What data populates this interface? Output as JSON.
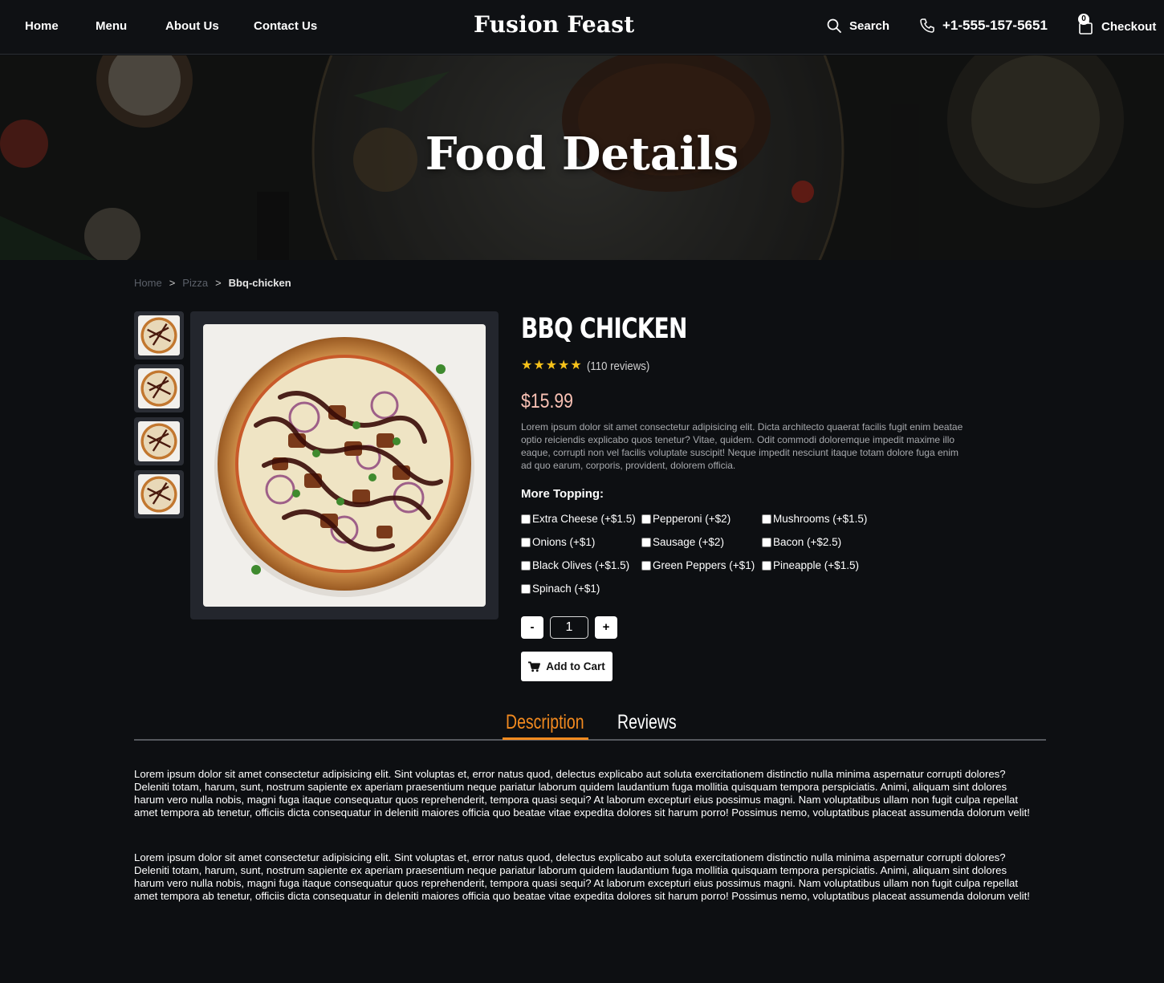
{
  "nav": {
    "links": [
      "Home",
      "Menu",
      "About Us",
      "Contact Us"
    ],
    "brand": "Fusion Feast",
    "search_label": "Search",
    "phone": "+1-555-157-5651",
    "cart_count": "0",
    "checkout_label": "Checkout"
  },
  "hero": {
    "title": "Food Details"
  },
  "breadcrumb": {
    "home": "Home",
    "category": "Pizza",
    "current": "Bbq-chicken",
    "separator": ">"
  },
  "product": {
    "title": "BBQ CHICKEN",
    "rating": 5,
    "reviews": "(110 reviews)",
    "price": "$15.99",
    "short_description": "Lorem ipsum dolor sit amet consectetur adipisicing elit. Dicta architecto quaerat facilis fugit enim beatae optio reiciendis explicabo quos tenetur? Vitae, quidem. Odit commodi doloremque impedit maxime illo eaque, corrupti non vel facilis voluptate suscipit! Neque impedit nesciunt itaque totam dolore fuga enim ad quo earum, corporis, provident, dolorem officia.",
    "topping_heading": "More Topping:",
    "toppings": [
      "Extra Cheese (+$1.5)",
      "Pepperoni (+$2)",
      "Mushrooms (+$1.5)",
      "Onions (+$1)",
      "Sausage (+$2)",
      "Bacon (+$2.5)",
      "Black Olives (+$1.5)",
      "Green Peppers (+$1)",
      "Pineapple (+$1.5)",
      "Spinach (+$1)"
    ],
    "quantity": "1",
    "minus_label": "-",
    "plus_label": "+",
    "add_to_cart": "Add to Cart"
  },
  "tabs": {
    "description": "Description",
    "reviews": "Reviews"
  },
  "description_paragraphs": [
    "Lorem ipsum dolor sit amet consectetur adipisicing elit. Sint voluptas et, error natus quod, delectus explicabo aut soluta exercitationem distinctio nulla minima aspernatur corrupti dolores? Deleniti totam, harum, sunt, nostrum sapiente ex aperiam praesentium neque pariatur laborum quidem laudantium fuga mollitia quisquam tempora perspiciatis. Animi, aliquam sint dolores harum vero nulla nobis, magni fuga itaque consequatur quos reprehenderit, tempora quasi sequi? At laborum excepturi eius possimus magni. Nam voluptatibus ullam non fugit culpa repellat amet tempora ab tenetur, officiis dicta consequatur in deleniti maiores officia quo beatae vitae expedita dolores sit harum porro! Possimus nemo, voluptatibus placeat assumenda dolorum velit!",
    "Lorem ipsum dolor sit amet consectetur adipisicing elit. Sint voluptas et, error natus quod, delectus explicabo aut soluta exercitationem distinctio nulla minima aspernatur corrupti dolores? Deleniti totam, harum, sunt, nostrum sapiente ex aperiam praesentium neque pariatur laborum quidem laudantium fuga mollitia quisquam tempora perspiciatis. Animi, aliquam sint dolores harum vero nulla nobis, magni fuga itaque consequatur quos reprehenderit, tempora quasi sequi? At laborum excepturi eius possimus magni. Nam voluptatibus ullam non fugit culpa repellat amet tempora ab tenetur, officiis dicta consequatur in deleniti maiores officia quo beatae vitae expedita dolores sit harum porro! Possimus nemo, voluptatibus placeat assumenda dolorum velit!"
  ],
  "colors": {
    "background": "#0d0f12",
    "accent": "#f28a1f",
    "price": "#f9c1b4",
    "star": "#f7c21a"
  },
  "icons": [
    "search-icon",
    "phone-icon",
    "shopping-bag-icon",
    "cart-icon",
    "star-icon"
  ]
}
